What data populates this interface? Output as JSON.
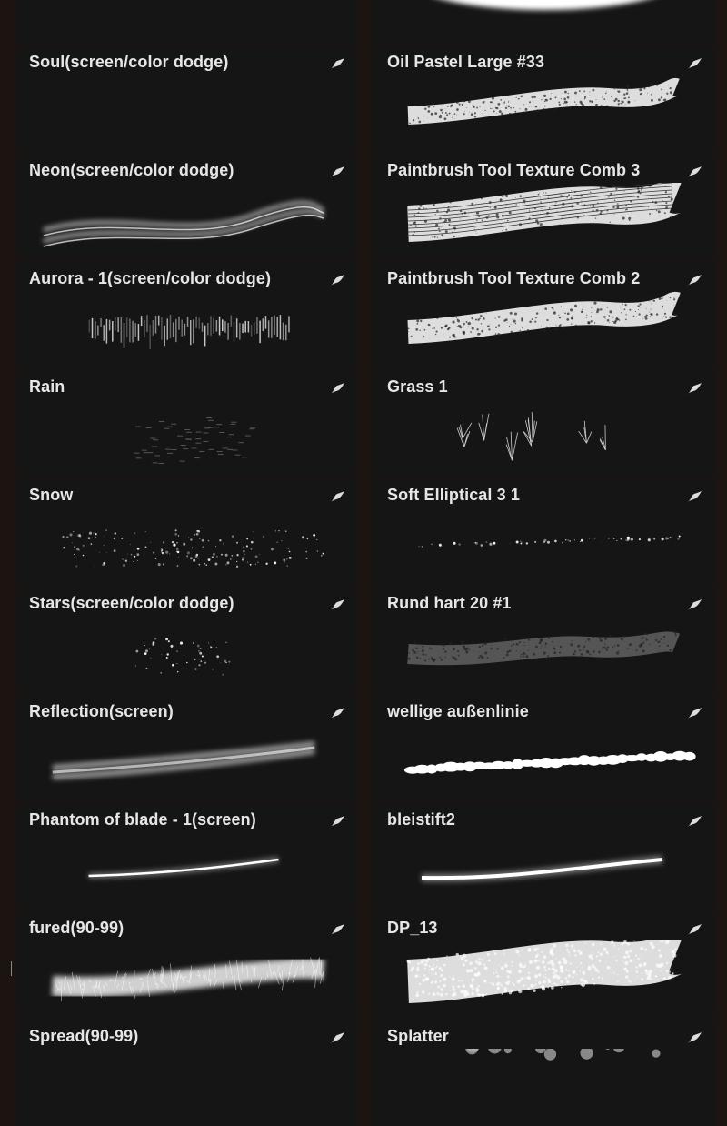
{
  "colors": {
    "background": "#1b1411",
    "card": "#151515",
    "text": "#e6e6e6",
    "stroke": "#ffffff"
  },
  "left_column": [
    {
      "title": "",
      "preview": "soft-glow"
    },
    {
      "title": "Soul(screen/color dodge)",
      "preview": "none"
    },
    {
      "title": "Neon(screen/color dodge)",
      "preview": "neon"
    },
    {
      "title": "Aurora - 1(screen/color dodge)",
      "preview": "aurora"
    },
    {
      "title": "Rain",
      "preview": "rain"
    },
    {
      "title": "Snow",
      "preview": "snow"
    },
    {
      "title": "Stars(screen/color dodge)",
      "preview": "stars"
    },
    {
      "title": "Reflection(screen)",
      "preview": "reflection"
    },
    {
      "title": "Phantom of blade - 1(screen)",
      "preview": "blade"
    },
    {
      "title": "fured(90-99)",
      "preview": "fur"
    },
    {
      "title": "Spread(90-99)",
      "preview": "none"
    }
  ],
  "right_column": [
    {
      "title": "",
      "preview": "soft-blob"
    },
    {
      "title": "Oil Pastel Large #33",
      "preview": "oil"
    },
    {
      "title": "Paintbrush Tool Texture Comb 3",
      "preview": "comb"
    },
    {
      "title": "Paintbrush Tool Texture Comb 2",
      "preview": "comb2"
    },
    {
      "title": "Grass 1",
      "preview": "grass"
    },
    {
      "title": "Soft Elliptical 3 1",
      "preview": "dotted"
    },
    {
      "title": "Rund hart 20 #1",
      "preview": "rough"
    },
    {
      "title": "wellige außenlinie",
      "preview": "blobs"
    },
    {
      "title": "bleistift2",
      "preview": "pencil"
    },
    {
      "title": "DP_13",
      "preview": "dots"
    },
    {
      "title": "Splatter",
      "preview": "splatter"
    }
  ],
  "icons": {
    "brush_settings": "feather-icon"
  }
}
